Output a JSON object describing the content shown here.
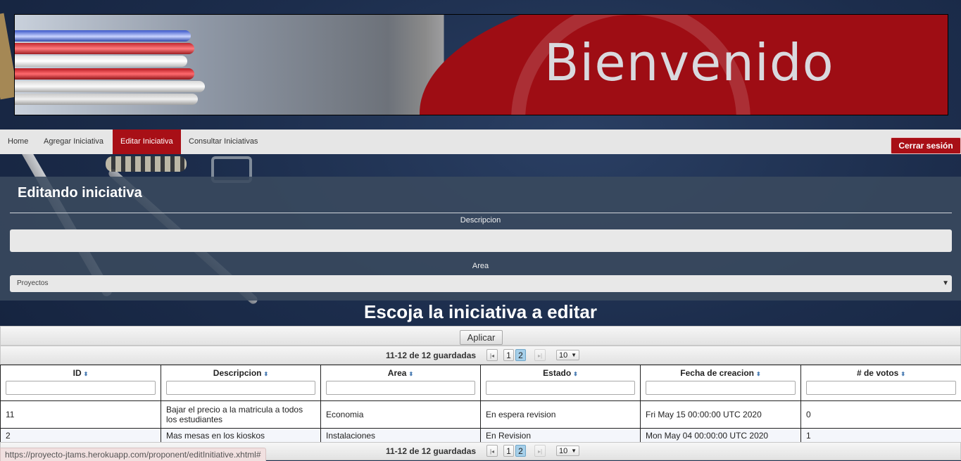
{
  "banner": {
    "title": "Bienvenido"
  },
  "nav": {
    "items": [
      {
        "label": "Home",
        "active": false
      },
      {
        "label": "Agregar Iniciativa",
        "active": false
      },
      {
        "label": "Editar Iniciativa",
        "active": true
      },
      {
        "label": "Consultar Iniciativas",
        "active": false
      }
    ],
    "logout_label": "Cerrar sesión"
  },
  "form": {
    "title": "Editando iniciativa",
    "description_label": "Descripcion",
    "description_value": "",
    "area_label": "Area",
    "area_selected": "Proyectos"
  },
  "section": {
    "title": "Escoja la iniciativa a editar"
  },
  "table": {
    "apply_label": "Aplicar",
    "paginator": {
      "summary": "11-12 de 12 guardadas",
      "pages": [
        "1",
        "2"
      ],
      "current_page": "2",
      "rows_per_page": "10"
    },
    "columns": [
      "ID",
      "Descripcion",
      "Area",
      "Estado",
      "Fecha de creacion",
      "# de votos"
    ],
    "rows": [
      {
        "id": "11",
        "descripcion": "Bajar el precio a la matricula a todos los estudiantes",
        "area": "Economia",
        "estado": "En espera revision",
        "fecha": "Fri May 15 00:00:00 UTC 2020",
        "votos": "0"
      },
      {
        "id": "2",
        "descripcion": "Mas mesas en los kioskos",
        "area": "Instalaciones",
        "estado": "En Revision",
        "fecha": "Mon May 04 00:00:00 UTC 2020",
        "votos": "1"
      }
    ]
  },
  "status_bar": {
    "url": "https://proyecto-jtams.herokuapp.com/proponent/editInitiative.xhtml#"
  },
  "colors": {
    "accent": "#a80f16",
    "panel": "#3a4a5e",
    "background": "#1c2d4c"
  }
}
